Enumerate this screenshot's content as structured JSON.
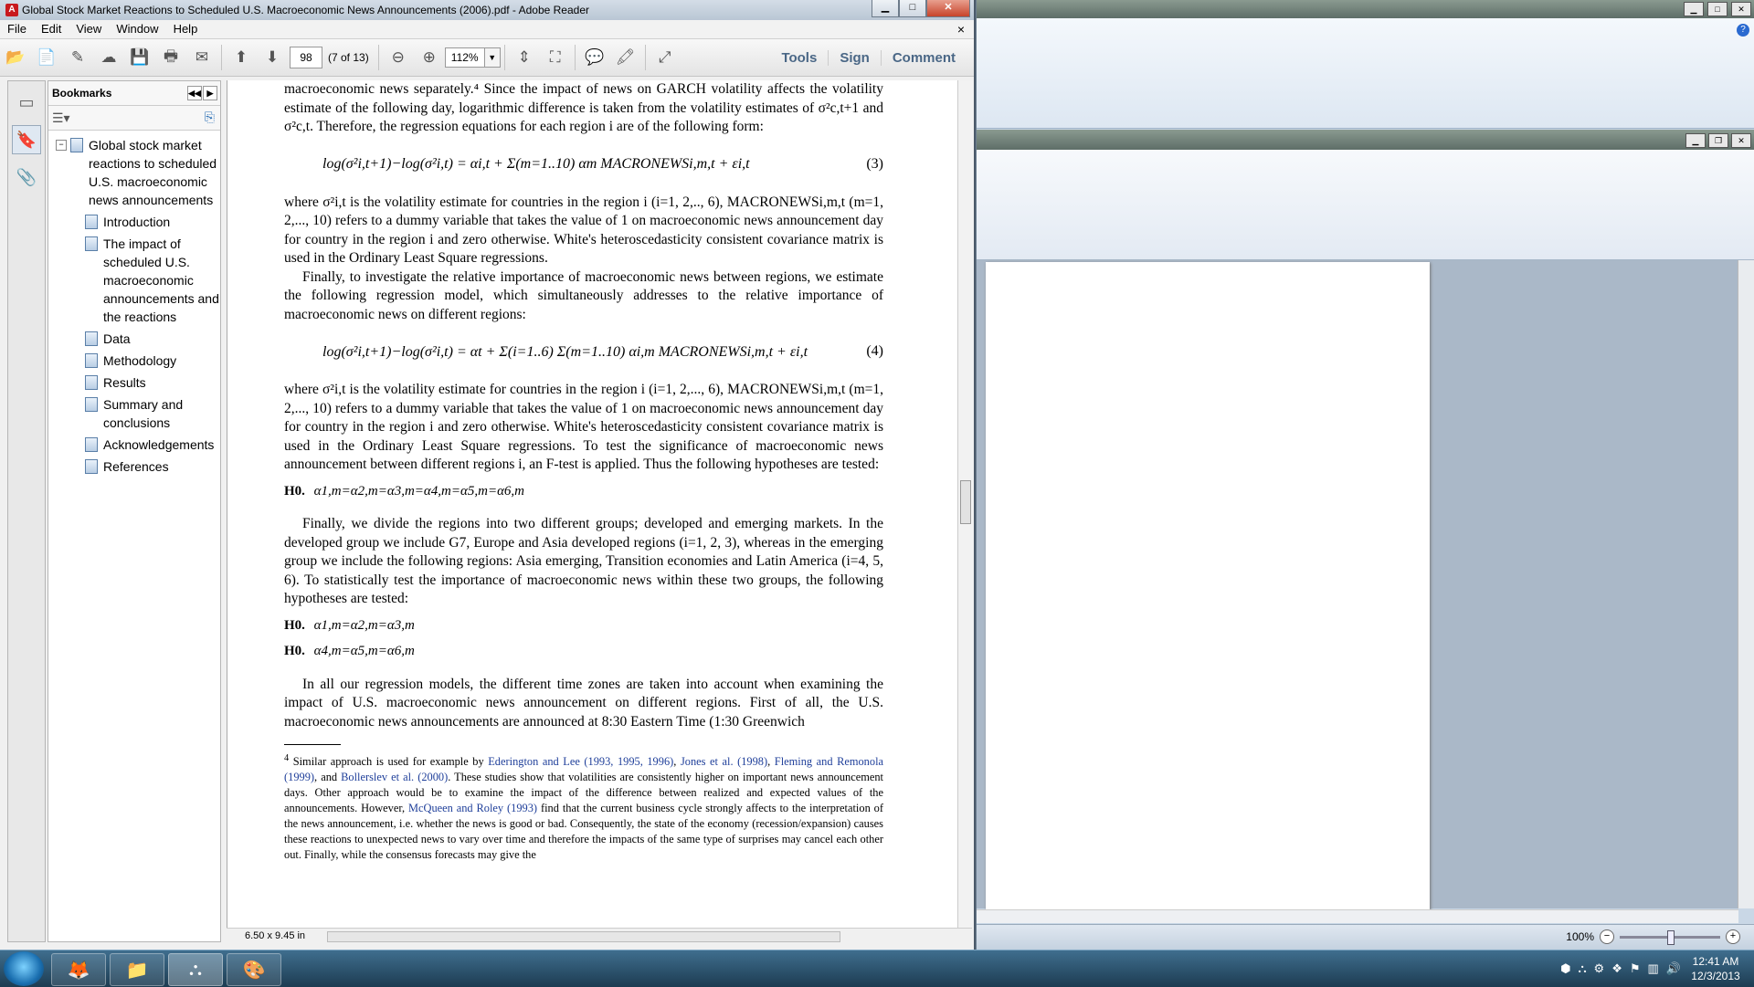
{
  "window": {
    "title": "Global Stock Market Reactions to Scheduled U.S. Macroeconomic News Announcements (2006).pdf - Adobe Reader",
    "minimize": "▁",
    "maximize": "□",
    "close": "✕"
  },
  "menu": {
    "items": [
      "File",
      "Edit",
      "View",
      "Window",
      "Help"
    ],
    "close": "×"
  },
  "toolbar": {
    "page_number": "98",
    "page_count": "(7 of 13)",
    "zoom": "112%",
    "tools": "Tools",
    "sign": "Sign",
    "comment": "Comment"
  },
  "bookmarks": {
    "title": "Bookmarks",
    "root": "Global stock market reactions to scheduled U.S. macroeconomic news announcements",
    "items": [
      "Introduction",
      "The impact of scheduled U.S. macroeconomic announcements and the reactions",
      "Data",
      "Methodology",
      "Results",
      "Summary and conclusions",
      "Acknowledgements",
      "References"
    ]
  },
  "doc": {
    "p1": "macroeconomic news separately.⁴ Since the impact of news on GARCH volatility affects the volatility estimate of the following day, logarithmic difference is taken from the volatility estimates of σ²c,t+1 and σ²c,t. Therefore, the regression equations for each region i are of the following form:",
    "eq3": "log(σ²i,t+1)−log(σ²i,t) = αi,t + Σ(m=1..10) αm MACRONEWSi,m,t + εi,t",
    "eq3_num": "(3)",
    "p2": "where σ²i,t is the volatility estimate for countries in the region i (i=1, 2,.., 6), MACRONEWSi,m,t (m=1, 2,..., 10) refers to a dummy variable that takes the value of 1 on macroeconomic news announcement day for country in the region i and zero otherwise. White's heteroscedasticity consistent covariance matrix is used in the Ordinary Least Square regressions.",
    "p3": "Finally, to investigate the relative importance of macroeconomic news between regions, we estimate the following regression model, which simultaneously addresses to the relative importance of macroeconomic news on different regions:",
    "eq4": "log(σ²i,t+1)−log(σ²i,t) = αt + Σ(i=1..6) Σ(m=1..10) αi,m MACRONEWSi,m,t + εi,t",
    "eq4_num": "(4)",
    "p4": "where σ²i,t is the volatility estimate for countries in the region i (i=1, 2,..., 6), MACRONEWSi,m,t (m=1, 2,..., 10) refers to a dummy variable that takes the value of 1 on macroeconomic news announcement day for country in the region i and zero otherwise. White's heteroscedasticity consistent covariance matrix is used in the Ordinary Least Square regressions. To test the significance of macroeconomic news announcement between different regions i, an F-test is applied. Thus the following hypotheses are tested:",
    "h_label": "H0.",
    "h1": "α1,m=α2,m=α3,m=α4,m=α5,m=α6,m",
    "p5": "Finally, we divide the regions into two different groups; developed and emerging markets. In the developed group we include G7, Europe and Asia developed regions (i=1, 2, 3), whereas in the emerging group we include the following regions: Asia emerging, Transition economies and Latin America (i=4, 5, 6). To statistically test the importance of macroeconomic news within these two groups, the following hypotheses are tested:",
    "h2": "α1,m=α2,m=α3,m",
    "h3": "α4,m=α5,m=α6,m",
    "p6": "In all our regression models, the different time zones are taken into account when examining the impact of U.S. macroeconomic news announcement on different regions. First of all, the U.S. macroeconomic news announcements are announced at 8:30 Eastern Time (1:30 Greenwich",
    "fn_num": "4",
    "fn_a": " Similar approach is used for example by ",
    "fn_link1": "Ederington and Lee (1993, 1995, 1996)",
    "fn_b": ", ",
    "fn_link2": "Jones et al. (1998)",
    "fn_c": ", ",
    "fn_link3": "Fleming and Remonola (1999)",
    "fn_d": ", and ",
    "fn_link4": "Bollerslev et al. (2000)",
    "fn_e": ". These studies show that volatilities are consistently higher on important news announcement days. Other approach would be to examine the impact of the difference between realized and expected values of the announcements. However, ",
    "fn_link5": "McQueen and Roley (1993)",
    "fn_f": " find that the current business cycle strongly affects to the interpretation of the news announcement, i.e. whether the news is good or bad. Consequently, the state of the economy (recession/expansion) causes these reactions to unexpected news to vary over time and therefore the impacts of the same type of surprises may cancel each other out. Finally, while the consensus forecasts may give the",
    "page_size": "6.50 x 9.45 in"
  },
  "bg_window": {
    "zoom": "100%"
  },
  "taskbar": {
    "time": "12:41 AM",
    "date": "12/3/2013"
  },
  "colors": {
    "link": "#1f3f9a",
    "tool_link": "#4a6786",
    "adobe_red": "#c8191d"
  }
}
